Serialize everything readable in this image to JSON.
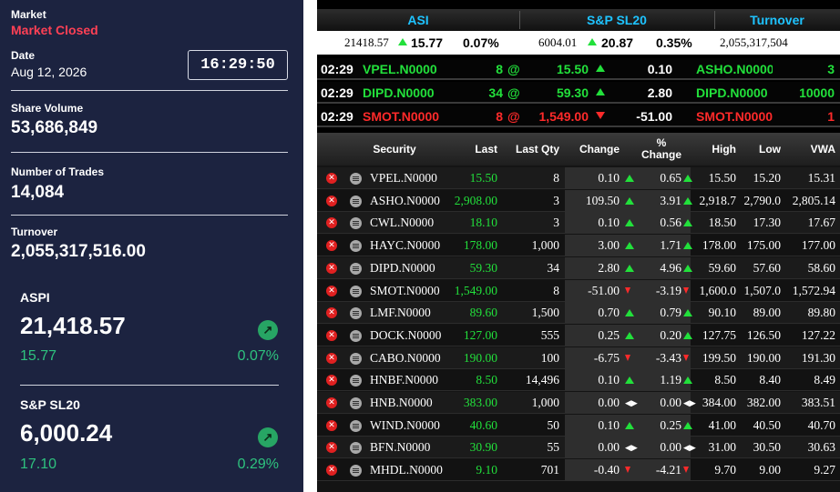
{
  "summary": {
    "market_label": "Market",
    "market_status": "Market Closed",
    "date_label": "Date",
    "date_value": "Aug 12, 2026",
    "clock": "16:29:50",
    "share_volume_label": "Share Volume",
    "share_volume": "53,686,849",
    "trades_label": "Number of Trades",
    "trades": "14,084",
    "turnover_label": "Turnover",
    "turnover": "2,055,317,516.00"
  },
  "indices": [
    {
      "name": "ASPI",
      "value": "21,418.57",
      "change": "15.77",
      "pct": "0.07%",
      "direction": "up-arrow-icon"
    },
    {
      "name": "S&P SL20",
      "value": "6,000.24",
      "change": "17.10",
      "pct": "0.29%",
      "direction": "up-arrow-icon"
    }
  ],
  "ticker_header": {
    "asi": "ASI",
    "sp": "S&P SL20",
    "turnover": "Turnover"
  },
  "ticker_values": {
    "asi_value": "21418.57",
    "asi_change": "15.77",
    "asi_pct": "0.07%",
    "sp_value": "6004.01",
    "sp_change": "20.87",
    "sp_pct": "0.35%",
    "turnover": "2,055,317,504"
  },
  "trades_feed": [
    {
      "time": "02:29",
      "symbol": "VPEL.N0000",
      "qty": "8",
      "at": "@",
      "price": "15.50",
      "dir": "up",
      "change": "0.10",
      "symbol2": "ASHO.N0000",
      "qty2": "3",
      "color": "#22e03b",
      "color2": "#22e03b"
    },
    {
      "time": "02:29",
      "symbol": "DIPD.N0000",
      "qty": "34",
      "at": "@",
      "price": "59.30",
      "dir": "up",
      "change": "2.80",
      "symbol2": "DIPD.N0000",
      "qty2": "10000",
      "color": "#22e03b",
      "color2": "#22e03b"
    },
    {
      "time": "02:29",
      "symbol": "SMOT.N0000",
      "qty": "8",
      "at": "@",
      "price": "1,549.00",
      "dir": "down",
      "change": "-51.00",
      "symbol2": "SMOT.N0000",
      "qty2": "1",
      "color": "#ff2a2a",
      "color2": "#ff2a2a"
    }
  ],
  "table": {
    "headers": {
      "security": "Security",
      "last": "Last",
      "last_qty": "Last Qty",
      "change": "Change",
      "pct_change": "% Change",
      "high": "High",
      "low": "Low",
      "vwa": "VWA"
    },
    "rows": [
      {
        "security": "VPEL.N0000",
        "last": "15.50",
        "last_qty": "8",
        "change": "0.10",
        "pct": "0.65",
        "dir": "up",
        "high": "15.50",
        "low": "15.20",
        "vwa": "15.31"
      },
      {
        "security": "ASHO.N0000",
        "last": "2,908.00",
        "last_qty": "3",
        "change": "109.50",
        "pct": "3.91",
        "dir": "up",
        "high": "2,918.7",
        "low": "2,790.0",
        "vwa": "2,805.14"
      },
      {
        "security": "CWL.N0000",
        "last": "18.10",
        "last_qty": "3",
        "change": "0.10",
        "pct": "0.56",
        "dir": "up",
        "high": "18.50",
        "low": "17.30",
        "vwa": "17.67"
      },
      {
        "security": "HAYC.N0000",
        "last": "178.00",
        "last_qty": "1,000",
        "change": "3.00",
        "pct": "1.71",
        "dir": "up",
        "high": "178.00",
        "low": "175.00",
        "vwa": "177.00"
      },
      {
        "security": "DIPD.N0000",
        "last": "59.30",
        "last_qty": "34",
        "change": "2.80",
        "pct": "4.96",
        "dir": "up",
        "high": "59.60",
        "low": "57.60",
        "vwa": "58.60"
      },
      {
        "security": "SMOT.N0000",
        "last": "1,549.00",
        "last_qty": "8",
        "change": "-51.00",
        "pct": "-3.19",
        "dir": "down",
        "high": "1,600.0",
        "low": "1,507.0",
        "vwa": "1,572.94"
      },
      {
        "security": "LMF.N0000",
        "last": "89.60",
        "last_qty": "1,500",
        "change": "0.70",
        "pct": "0.79",
        "dir": "up",
        "high": "90.10",
        "low": "89.00",
        "vwa": "89.80"
      },
      {
        "security": "DOCK.N0000",
        "last": "127.00",
        "last_qty": "555",
        "change": "0.25",
        "pct": "0.20",
        "dir": "up",
        "high": "127.75",
        "low": "126.50",
        "vwa": "127.22"
      },
      {
        "security": "CABO.N0000",
        "last": "190.00",
        "last_qty": "100",
        "change": "-6.75",
        "pct": "-3.43",
        "dir": "down",
        "high": "199.50",
        "low": "190.00",
        "vwa": "191.30"
      },
      {
        "security": "HNBF.N0000",
        "last": "8.50",
        "last_qty": "14,496",
        "change": "0.10",
        "pct": "1.19",
        "dir": "up",
        "high": "8.50",
        "low": "8.40",
        "vwa": "8.49"
      },
      {
        "security": "HNB.N0000",
        "last": "383.00",
        "last_qty": "1,000",
        "change": "0.00",
        "pct": "0.00",
        "dir": "eq",
        "high": "384.00",
        "low": "382.00",
        "vwa": "383.51"
      },
      {
        "security": "WIND.N0000",
        "last": "40.60",
        "last_qty": "50",
        "change": "0.10",
        "pct": "0.25",
        "dir": "up",
        "high": "41.00",
        "low": "40.50",
        "vwa": "40.70"
      },
      {
        "security": "BFN.N0000",
        "last": "30.90",
        "last_qty": "55",
        "change": "0.00",
        "pct": "0.00",
        "dir": "eq",
        "high": "31.00",
        "low": "30.50",
        "vwa": "30.63"
      },
      {
        "security": "MHDL.N0000",
        "last": "9.10",
        "last_qty": "701",
        "change": "-0.40",
        "pct": "-4.21",
        "dir": "down",
        "high": "9.70",
        "low": "9.00",
        "vwa": "9.27"
      }
    ]
  },
  "colors": {
    "up": "#22e03b",
    "down": "#ff2a2a",
    "accent": "#1ec3ff",
    "closed": "#ff4055",
    "panel": "#1c2340"
  }
}
